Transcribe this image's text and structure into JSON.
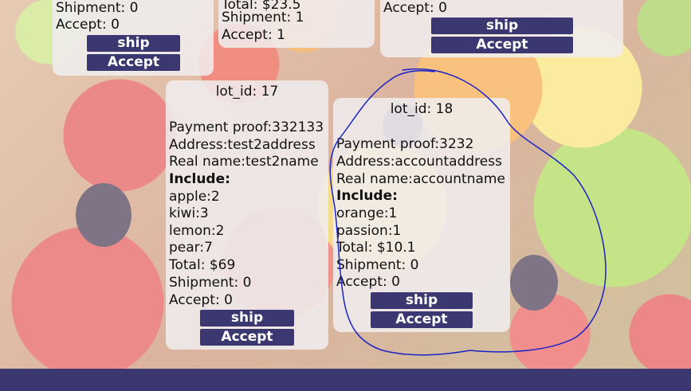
{
  "cards": [
    {
      "lines": [
        "Shipment: 0",
        "Accept: 0"
      ],
      "ship_label": "ship",
      "accept_label": "Accept"
    },
    {
      "lines": [
        "Total: $23.5",
        "Shipment: 1",
        "Accept: 1"
      ]
    },
    {
      "lines": [
        "Accept: 0"
      ],
      "ship_label": "ship",
      "accept_label": "Accept"
    },
    {
      "title": "lot_id: 17",
      "payment": "Payment proof:332133",
      "address": "Address:test2address",
      "realname": "Real name:test2name",
      "include_label": "Include:",
      "items": [
        "apple:2",
        "kiwi:3",
        "lemon:2",
        "pear:7"
      ],
      "total": "Total: $69",
      "shipment": "Shipment: 0",
      "accept": "Accept: 0",
      "ship_label": "ship",
      "accept_label": "Accept"
    },
    {
      "title": "lot_id: 18",
      "payment": "Payment proof:3232",
      "address": "Address:accountaddress",
      "realname": "Real name:accountname",
      "include_label": "Include:",
      "items": [
        "orange:1",
        "passion:1"
      ],
      "total": "Total: $10.1",
      "shipment": "Shipment: 0",
      "accept": "Accept: 0",
      "ship_label": "ship",
      "accept_label": "Accept"
    }
  ],
  "colors": {
    "button_bg": "#3b3770",
    "footer_bg": "#3b3770",
    "annotation_stroke": "#1a22c8"
  }
}
